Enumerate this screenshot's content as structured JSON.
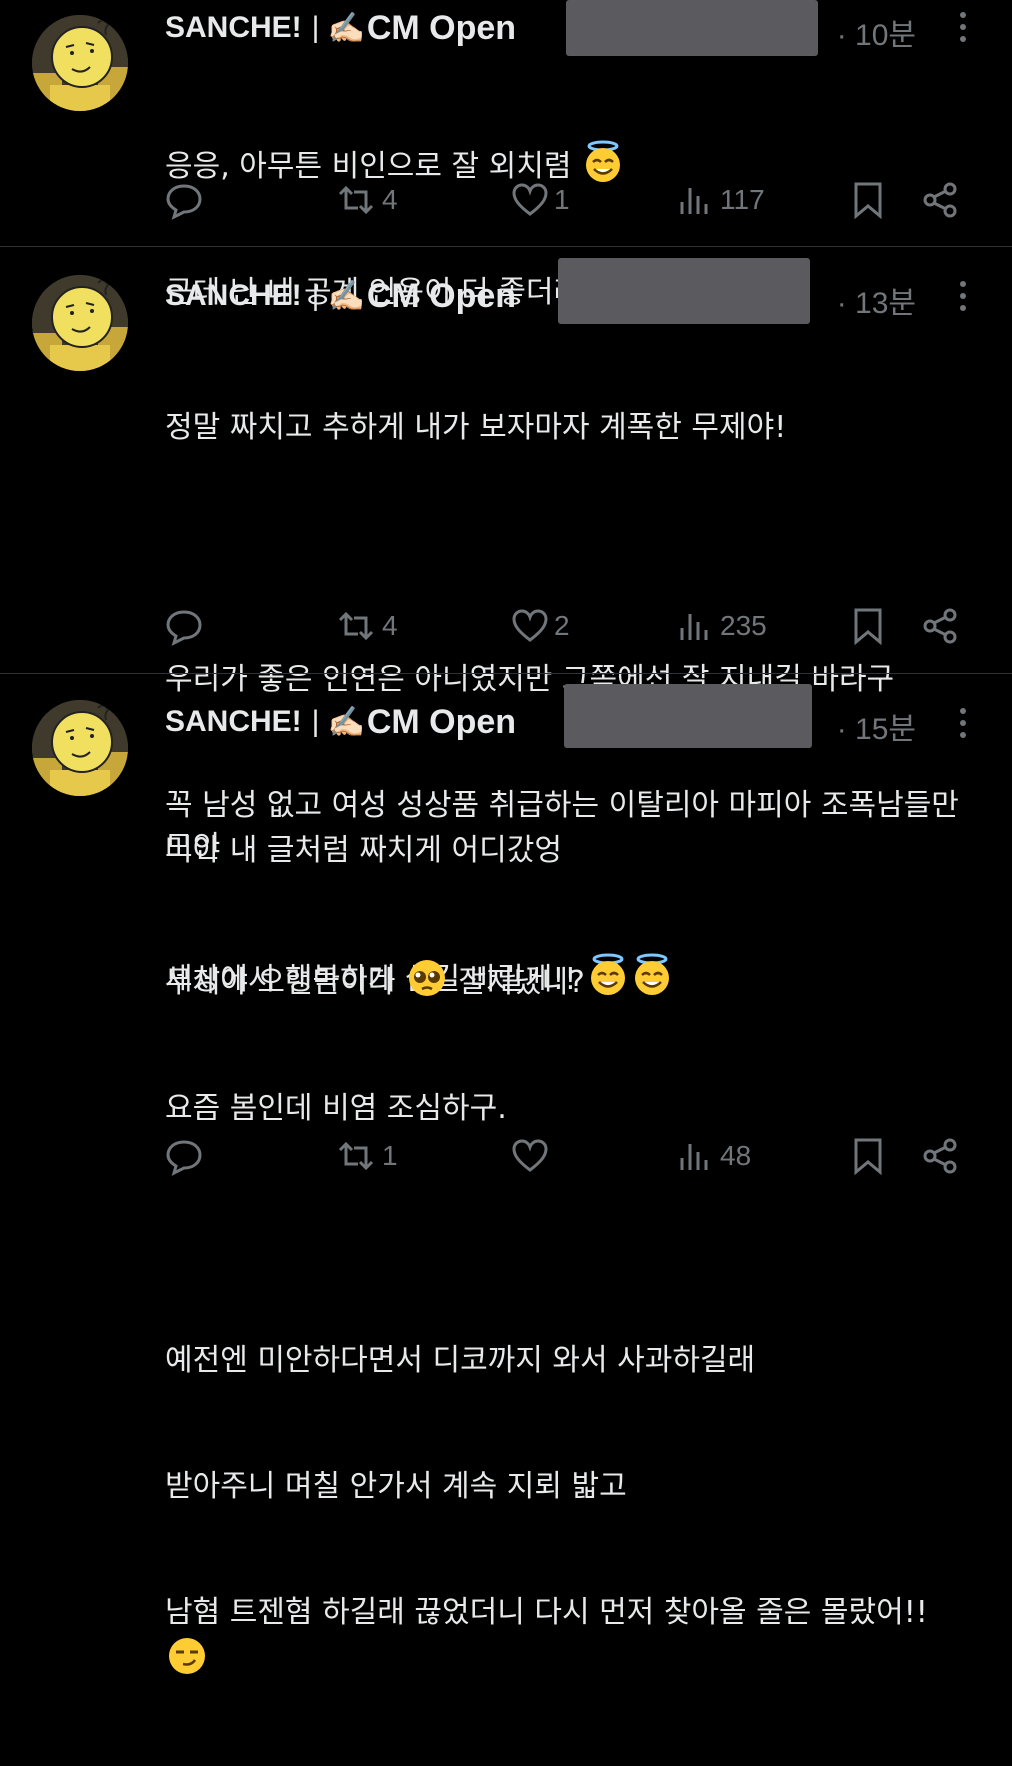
{
  "tweets": [
    {
      "display_name": "SANCHE!",
      "separator": "|",
      "cm_open": "CM Open",
      "time": "· 10분",
      "lines": [
        "응응, 아무튼 비인으로 잘 외치렴",
        "근데 난 네 공계 인용이 더 좋더라"
      ],
      "stats": {
        "retweets": "4",
        "likes": "1",
        "views": "117"
      }
    },
    {
      "display_name": "SANCHE!",
      "separator": "|",
      "cm_open": "CM Open",
      "time": "· 13분",
      "lines": [
        "정말 짜치고 추하게 내가 보자마자 계폭한 무제야!",
        "",
        "우리가 좋은 인연은 아니였지만 그쪽에선 잘 지내길 바라구",
        "꼭 남성 없고 여성 성상품 취급하는 이탈리아 마피아 조폭남들만 모인",
        "세상에서 행복하게 살길 바랄게!!"
      ],
      "stats": {
        "retweets": "4",
        "likes": "2",
        "views": "235"
      }
    },
    {
      "display_name": "SANCHE!",
      "separator": "|",
      "cm_open": "CM Open",
      "time": "· 15분",
      "lines": [
        "머야 내 글처럼 짜치게 어디갔엉",
        "무제야 오랜만이다",
        "잘지냈니?",
        "요즘 봄인데 비염 조심하구.",
        "",
        "예전엔 미안하다면서 디코까지 와서 사과하길래",
        "받아주니 며칠 안가서 계속 지뢰 밟고",
        "남혐 트젠혐 하길래 끊었더니 다시 먼저 찾아올 줄은 몰랐어!!"
      ],
      "stats": {
        "retweets": "1",
        "likes": "",
        "views": "48"
      }
    }
  ],
  "icons": [
    "reply-icon",
    "retweet-icon",
    "like-icon",
    "views-icon",
    "bookmark-icon",
    "share-icon",
    "more-icon",
    "writing-hand-emoji",
    "halo-smile-emoji",
    "pleading-emoji",
    "smirk-emoji"
  ],
  "colors": {
    "background": "#000000",
    "text": "#e7e9ea",
    "muted": "#71767b",
    "divider": "#2f3336",
    "redaction": "#5b5b5f"
  }
}
